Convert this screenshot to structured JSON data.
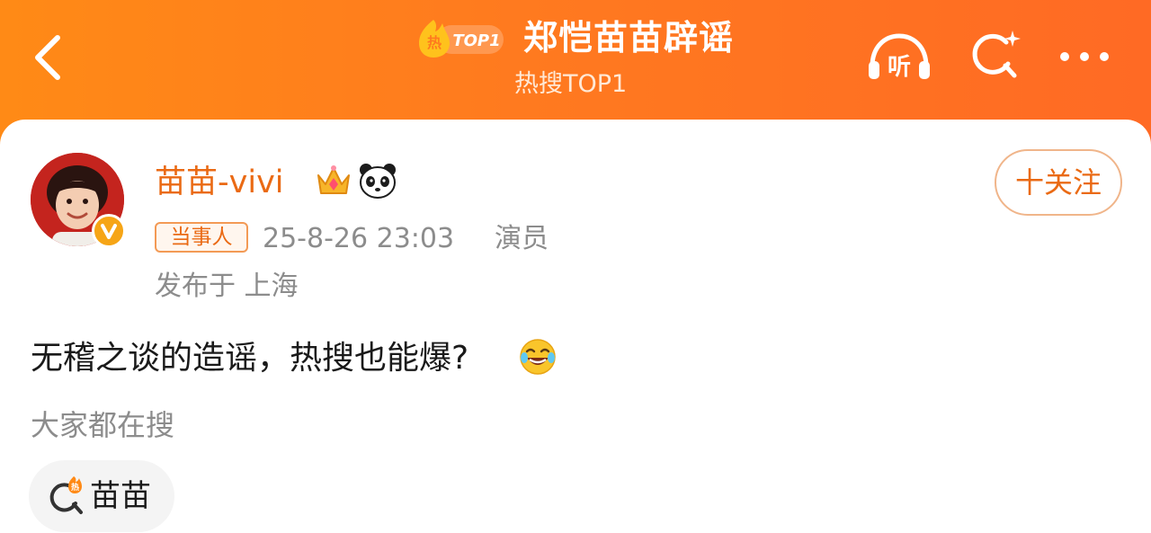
{
  "header": {
    "badge_hot": "热",
    "badge_top": "TOP1",
    "title": "郑恺苗苗辟谣",
    "subtitle": "热搜TOP1",
    "listen_label": "听"
  },
  "post": {
    "username": "苗苗-vivi",
    "role_tag": "当事人",
    "time": "25-8-26 23:03",
    "user_title": "演员",
    "location": "发布于 上海",
    "follow_label": "十关注",
    "text": "无稽之谈的造谣，热搜也能爆?"
  },
  "trending": {
    "section_title": "大家都在搜",
    "items": [
      {
        "label": "苗苗",
        "icon_hot": "热"
      }
    ]
  },
  "icons": [
    "back-arrow-icon",
    "hot-top-badge-icon",
    "listen-headphones-icon",
    "search-sparkle-icon",
    "more-dots-icon",
    "crown-icon",
    "panda-icon",
    "verified-v-icon",
    "laugh-emoji-icon",
    "hot-search-icon"
  ],
  "colors": {
    "header_start": "#ff8a16",
    "header_end": "#ff6a24",
    "accent": "#ea6a14",
    "muted_text": "#8c8c8c"
  }
}
